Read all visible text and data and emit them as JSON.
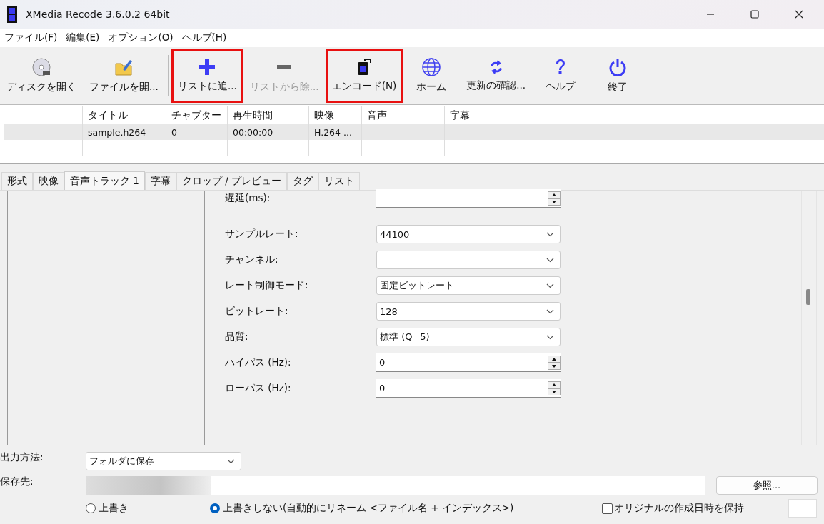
{
  "window": {
    "title": "XMedia Recode 3.6.0.2 64bit"
  },
  "menu": [
    "ファイル(F)",
    "編集(E)",
    "オプション(O)",
    "ヘルプ(H)"
  ],
  "toolbar": [
    {
      "label": "ディスクを開く",
      "disabled": false,
      "highlighted": false
    },
    {
      "label": "ファイルを開...",
      "disabled": false,
      "highlighted": false
    },
    {
      "label": "リストに追...",
      "disabled": false,
      "highlighted": true
    },
    {
      "label": "リストから除...",
      "disabled": true,
      "highlighted": false
    },
    {
      "label": "エンコード(N)",
      "disabled": false,
      "highlighted": true
    },
    {
      "label": "ホーム",
      "disabled": false,
      "highlighted": false
    },
    {
      "label": "更新の確認...",
      "disabled": false,
      "highlighted": false
    },
    {
      "label": "ヘルプ",
      "disabled": false,
      "highlighted": false
    },
    {
      "label": "終了",
      "disabled": false,
      "highlighted": false
    }
  ],
  "file_list": {
    "columns": [
      "タイトル",
      "チャプター",
      "再生時間",
      "映像",
      "音声",
      "字幕"
    ],
    "rows": [
      {
        "selected": true,
        "cells": [
          "sample.h264",
          "0",
          "00:00:00",
          "H.264 ...",
          "",
          ""
        ]
      }
    ]
  },
  "tabs": [
    {
      "label": "形式",
      "selected": false
    },
    {
      "label": "映像",
      "selected": false
    },
    {
      "label": "音声トラック 1",
      "selected": true
    },
    {
      "label": "字幕",
      "selected": false
    },
    {
      "label": "クロップ / プレビュー",
      "selected": false
    },
    {
      "label": "タグ",
      "selected": false
    },
    {
      "label": "リスト",
      "selected": false
    }
  ],
  "audio_settings": [
    {
      "kind": "spin",
      "label": "遅延(ms):"
    },
    {
      "kind": "select",
      "label": "サンプルレート:",
      "value": "44100"
    },
    {
      "kind": "select",
      "label": "チャンネル:"
    },
    {
      "kind": "select",
      "label": "レート制御モード:",
      "value": "固定ビットレート"
    },
    {
      "kind": "select",
      "label": "ビットレート:",
      "value": "128"
    },
    {
      "kind": "select",
      "label": "品質:",
      "value": "標準 (Q=5)"
    },
    {
      "kind": "spin",
      "label": "ハイパス (Hz):",
      "value": "0"
    },
    {
      "kind": "spin",
      "label": "ローパス (Hz):",
      "value": "0"
    }
  ],
  "output": {
    "method_label": "出力方法:",
    "method_value": "フォルダに保存",
    "dest_label": "保存先:",
    "browse_button": "参照...",
    "options": [
      {
        "label": "上書き",
        "selected": false
      },
      {
        "label": "上書きしない(自動的にリネーム <ファイル名 + インデックス>)",
        "selected": true
      }
    ],
    "keep_date": {
      "label": "オリジナルの作成日時を保持",
      "checked": false
    }
  }
}
